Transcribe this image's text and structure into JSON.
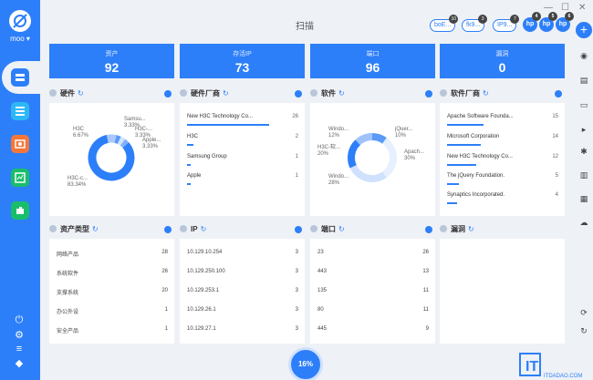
{
  "user": "moo",
  "page_title": "扫描",
  "target_pills": [
    {
      "label": "boE...",
      "count": "10"
    },
    {
      "label": "fk9...",
      "count": "3"
    },
    {
      "label": "IP9...",
      "count": "7"
    }
  ],
  "hp_icons": [
    {
      "label": "hp",
      "count": "4"
    },
    {
      "label": "hp",
      "count": "5"
    },
    {
      "label": "hp",
      "count": "6"
    }
  ],
  "stats": [
    {
      "label": "资产",
      "value": "92"
    },
    {
      "label": "存活IP",
      "value": "73"
    },
    {
      "label": "端口",
      "value": "96"
    },
    {
      "label": "漏洞",
      "value": "0"
    }
  ],
  "hardware": {
    "title": "硬件",
    "chart_data": {
      "type": "pie",
      "labels": [
        "H3C-...",
        "H3C",
        "Samsu...",
        "H3C-...",
        "Apple"
      ],
      "display_labels": [
        "H3C-c...",
        "H3C",
        "Samsu...",
        "H3C-...",
        "Apple..."
      ],
      "values": [
        83.34,
        6.67,
        3.33,
        3.33,
        3.33
      ],
      "value_labels": [
        "83.34%",
        "6.67%",
        "3.33%",
        "3.33%",
        "3.33%"
      ]
    }
  },
  "hw_vendors": {
    "title": "硬件厂商",
    "rows": [
      {
        "name": "New H3C Technology Co...",
        "count": "26",
        "frac": 1
      },
      {
        "name": "H3C",
        "count": "2",
        "frac": 0.08
      },
      {
        "name": "Samsung Group",
        "count": "1",
        "frac": 0.04
      },
      {
        "name": "Apple",
        "count": "1",
        "frac": 0.04
      }
    ]
  },
  "software": {
    "title": "软件",
    "chart_data": {
      "type": "pie",
      "labels": [
        "jQuer...",
        "Apach...",
        "Windo...",
        "H3C-软...",
        "Windo..."
      ],
      "values": [
        10,
        30,
        28,
        20,
        12
      ],
      "value_labels": [
        "10%",
        "30%",
        "28%",
        "20%",
        "12%"
      ]
    }
  },
  "sw_vendors": {
    "title": "软件厂商",
    "rows": [
      {
        "name": "Apache Software Founda...",
        "count": "15",
        "frac": 1
      },
      {
        "name": "Microsoft Corporation",
        "count": "14",
        "frac": 0.93
      },
      {
        "name": "New H3C Technology Co...",
        "count": "12",
        "frac": 0.8
      },
      {
        "name": "The jQuery Foundation.",
        "count": "5",
        "frac": 0.33
      },
      {
        "name": "Synaptics Incorporated.",
        "count": "4",
        "frac": 0.27
      }
    ]
  },
  "asset_types": {
    "title": "资产类型",
    "rows": [
      {
        "name": "网络产品",
        "count": "28"
      },
      {
        "name": "系统软件",
        "count": "26"
      },
      {
        "name": "支撑系统",
        "count": "20"
      },
      {
        "name": "办公外设",
        "count": "1"
      },
      {
        "name": "安全产品",
        "count": "1"
      }
    ]
  },
  "ips": {
    "title": "IP",
    "rows": [
      {
        "name": "10.129.10.254",
        "count": "3"
      },
      {
        "name": "10.129.250.100",
        "count": "3"
      },
      {
        "name": "10.129.253.1",
        "count": "3"
      },
      {
        "name": "10.129.26.1",
        "count": "3"
      },
      {
        "name": "10.129.27.1",
        "count": "3"
      }
    ]
  },
  "ports": {
    "title": "端口",
    "rows": [
      {
        "name": "23",
        "count": "26"
      },
      {
        "name": "443",
        "count": "13"
      },
      {
        "name": "135",
        "count": "11"
      },
      {
        "name": "80",
        "count": "11"
      },
      {
        "name": "445",
        "count": "9"
      }
    ]
  },
  "vulns": {
    "title": "漏洞",
    "rows": []
  },
  "progress": "16%",
  "watermark": {
    "brand": "IT",
    "domain": "ITDADAO.COM"
  },
  "colors": {
    "accent": "#2d7ff9",
    "bg": "#eef1f6"
  },
  "icons": {
    "sidebar": [
      "asset-icon",
      "list-icon",
      "image-icon",
      "chart-icon",
      "plugin-icon"
    ]
  }
}
